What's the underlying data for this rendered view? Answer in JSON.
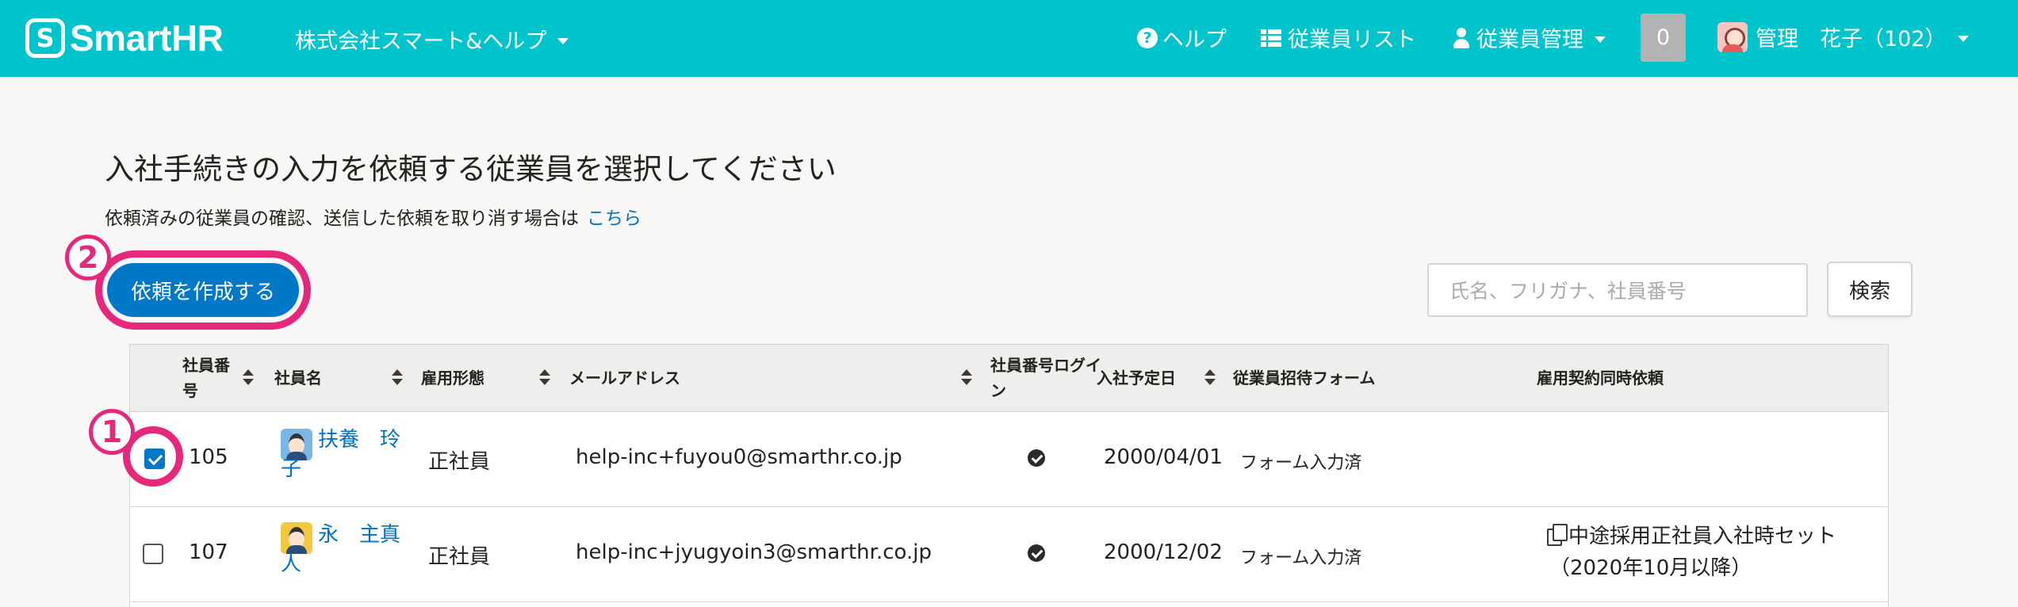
{
  "header": {
    "logo_mark": "S",
    "logo_text": "SmartHR",
    "company": "株式会社スマート&ヘルプ",
    "nav": {
      "help": "ヘルプ",
      "employee_list": "従業員リスト",
      "employee_admin": "従業員管理"
    },
    "notification_count": "0",
    "user_name": "管理　花子（102）"
  },
  "main": {
    "title": "入社手続きの入力を依頼する従業員を選択してください",
    "sub_text": "依頼済みの従業員の確認、送信した依頼を取り消す場合は",
    "sub_link": "こちら",
    "create_button": "依頼を作成する",
    "search_placeholder": "氏名、フリガナ、社員番号",
    "search_button": "検索",
    "markers": {
      "one": "1",
      "two": "2"
    }
  },
  "colors": {
    "header_bg": "#00c4cc",
    "primary": "#0077c7",
    "marker": "#e6287d"
  },
  "table": {
    "headers": {
      "emp_no": "社員番号",
      "emp_name": "社員名",
      "employment_type": "雇用形態",
      "email": "メールアドレス",
      "login": "社員番号ログイン",
      "join_date": "入社予定日",
      "invite_form": "従業員招待フォーム",
      "contract": "雇用契約同時依頼"
    },
    "rows": [
      {
        "checked": true,
        "emp_no": "105",
        "name": "扶養　玲子",
        "employment_type": "正社員",
        "email": "help-inc+fuyou0@smarthr.co.jp",
        "login_icon": "check-circle",
        "join_date": "2000/04/01",
        "form_status": "フォーム入力済",
        "contract": ""
      },
      {
        "checked": false,
        "emp_no": "107",
        "name": "永　主真人",
        "employment_type": "正社員",
        "email": "help-inc+jyugyoin3@smarthr.co.jp",
        "login_icon": "check-circle",
        "join_date": "2000/12/02",
        "form_status": "フォーム入力済",
        "contract": "中途採用正社員入社時セット（2020年10月以降）"
      }
    ]
  }
}
